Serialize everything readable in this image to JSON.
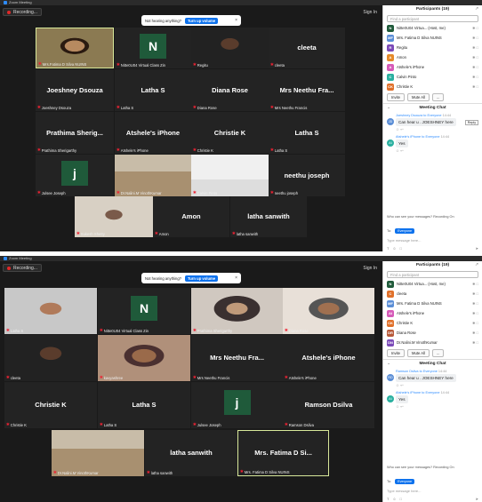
{
  "app": {
    "title": "Zoom Meeting",
    "recording_label": "Recording...",
    "sign_in": "Sign In"
  },
  "notice": {
    "text": "Not hearing anything?",
    "button": "Turn up volume",
    "close": "×"
  },
  "top": {
    "tiles": [
      {
        "name": "",
        "caption": "Mrs.Fatima D Silva NUINS",
        "type": "video",
        "skin": "skin1",
        "speaking": true
      },
      {
        "name": "",
        "caption": "Nitte0U04 Virtual Class Zin",
        "type": "avatar",
        "letter": "N"
      },
      {
        "name": "",
        "caption": "Regitu",
        "type": "video",
        "skin": "skin2"
      },
      {
        "name": "cleeta",
        "caption": "cleeta",
        "type": "name"
      },
      {
        "name": "Joeshney Dsouza",
        "caption": "Joeshney Dsouza",
        "type": "name"
      },
      {
        "name": "Latha S",
        "caption": "Latha S",
        "type": "name"
      },
      {
        "name": "Diana Rose",
        "caption": "Diana Rose",
        "type": "name"
      },
      {
        "name": "Mrs Neethu Fra...",
        "caption": "Mrs Neethu Francis",
        "type": "name"
      },
      {
        "name": "Prathima Sherig...",
        "caption": "Prathima Sherigarthy",
        "type": "name"
      },
      {
        "name": "Atshele's iPhone",
        "caption": "Atshele's iPhone",
        "type": "name"
      },
      {
        "name": "Christie K",
        "caption": "Christie K",
        "type": "name"
      },
      {
        "name": "Latha S",
        "caption": "Latha S",
        "type": "name"
      },
      {
        "name": "",
        "caption": "Julsee Joseph",
        "type": "avatar",
        "letter": "j"
      },
      {
        "name": "",
        "caption": "Dr.Nalini.M VinothKumar",
        "type": "video",
        "skin": "skin3"
      },
      {
        "name": "",
        "caption": "Calvin Pinto",
        "type": "video",
        "skin": "skin8"
      },
      {
        "name": "neethu joseph",
        "caption": "neethu joseph",
        "type": "name"
      },
      {
        "name": "",
        "caption": "Sukesh Shetty",
        "type": "video",
        "skin": "skin4"
      },
      {
        "name": "Amon",
        "caption": "Amon",
        "type": "name"
      },
      {
        "name": "latha sanwith",
        "caption": "latha sanwith",
        "type": "name"
      }
    ],
    "panel": {
      "title": "Participants (19)",
      "search_placeholder": "Find a participant",
      "rows": [
        {
          "initial": "N",
          "name": "Nitte0U04 Virtua... (Host, me)",
          "color": "#1f5a3a"
        },
        {
          "initial": "MF",
          "name": "Mrs. Fatima D Silva NUINS",
          "color": "#5b8ed6"
        },
        {
          "initial": "R",
          "name": "Regitu",
          "color": "#7b4ab8"
        },
        {
          "initial": "A",
          "name": "Amon",
          "color": "#e58a2a"
        },
        {
          "initial": "A",
          "name": "Atshele's iPhone",
          "color": "#d65ab8"
        },
        {
          "initial": "C",
          "name": "Calvin Pinto",
          "color": "#2ab0a0"
        },
        {
          "initial": "CK",
          "name": "Christie K",
          "color": "#e0702a"
        }
      ],
      "invite": "Invite",
      "mute_all": "Mute All",
      "more": "...",
      "chat_title": "Meeting Chat",
      "messages": [
        {
          "from": "Joeshney Dsouza",
          "to": "to Everyone",
          "time": "14:44",
          "initials": "JD",
          "color": "#5b8ed6",
          "text": "Can hear u . JOESHNEY here"
        },
        {
          "from": "Atshele's iPhone",
          "to": "to Everyone",
          "time": "14:44",
          "initials": "AI",
          "color": "#2ab0a0",
          "text": "Yes"
        }
      ],
      "reply": "Reply",
      "who_can_see": "Who can see your messages? Recording On",
      "to_label": "To:",
      "to_value": "Everyone",
      "type_placeholder": "Type message here..."
    }
  },
  "bottom": {
    "tiles": [
      {
        "name": "",
        "caption": "Latha S",
        "type": "video",
        "skin": "skin5"
      },
      {
        "name": "",
        "caption": "Nitte0U04 Virtual Class Zin",
        "type": "avatar",
        "letter": "N"
      },
      {
        "name": "",
        "caption": "Prathima Sherigarthy",
        "type": "video",
        "skin": "skin6"
      },
      {
        "name": "",
        "caption": "Diana Rose",
        "type": "video",
        "skin": "skin9"
      },
      {
        "name": "",
        "caption": "cleeta",
        "type": "video",
        "skin": "skin2"
      },
      {
        "name": "",
        "caption": "kavyashree",
        "type": "video",
        "skin": "skin7"
      },
      {
        "name": "Mrs Neethu Fra...",
        "caption": "Mrs Neethu Francis",
        "type": "name"
      },
      {
        "name": "Atshele's iPhone",
        "caption": "Atshele's iPhone",
        "type": "name"
      },
      {
        "name": "Christie K",
        "caption": "Christie K",
        "type": "name"
      },
      {
        "name": "Latha S",
        "caption": "Latha S",
        "type": "name"
      },
      {
        "name": "",
        "caption": "Julsee Joseph",
        "type": "avatar",
        "letter": "j"
      },
      {
        "name": "Ramson Dsilva",
        "caption": "Ramson Dsilva",
        "type": "name"
      },
      {
        "name": "",
        "caption": "Dr.Nalini.M VinothKumar",
        "type": "video",
        "skin": "skin3"
      },
      {
        "name": "latha sanwith",
        "caption": "latha sanwith",
        "type": "name"
      },
      {
        "name": "Mrs. Fatima D Si...",
        "caption": "Mrs. Fatima D Silva NUINS",
        "type": "name",
        "speaking": true
      }
    ],
    "panel": {
      "title": "Participants (19)",
      "search_placeholder": "Find a participant",
      "rows": [
        {
          "initial": "N",
          "name": "Nitte0U04 Virtua... (Host, me)",
          "color": "#1f5a3a"
        },
        {
          "initial": "C",
          "name": "cleeta",
          "color": "#e0702a"
        },
        {
          "initial": "MF",
          "name": "Mrs. Fatima D Silva NUINS",
          "color": "#5b8ed6"
        },
        {
          "initial": "AI",
          "name": "Atshele's iPhone",
          "color": "#d65ab8"
        },
        {
          "initial": "CK",
          "name": "Christie K",
          "color": "#e0702a"
        },
        {
          "initial": "DR",
          "name": "Diana Rose",
          "color": "#b85a3a"
        },
        {
          "initial": "DN",
          "name": "Dr.Nalini.M VinothKumar",
          "color": "#7b4ab8"
        }
      ],
      "invite": "Invite",
      "mute_all": "Mute All",
      "more": "...",
      "chat_title": "Meeting Chat",
      "messages": [
        {
          "from": "Ramson Dsilva",
          "to": "to Everyone",
          "time": "14:44",
          "initials": "RD",
          "color": "#5b8ed6",
          "text": "Can hear u . JOESHNEY here"
        },
        {
          "from": "Atshele's iPhone",
          "to": "to Everyone",
          "time": "14:44",
          "initials": "AI",
          "color": "#2ab0a0",
          "text": "Yes"
        }
      ],
      "reply": "",
      "who_can_see": "Who can see your messages? Recording On",
      "to_label": "To:",
      "to_value": "Everyone",
      "type_placeholder": "Type message here..."
    }
  }
}
